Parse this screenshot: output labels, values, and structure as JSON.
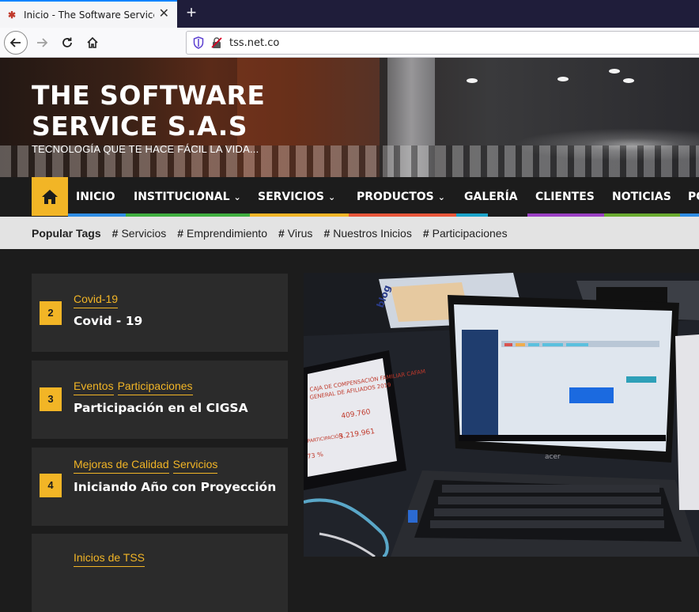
{
  "browser": {
    "tab_title": "Inicio - The Software Service S.A.S",
    "tab_close": "✕",
    "new_tab": "+",
    "url": "tss.net.co"
  },
  "site": {
    "title_line1": "THE SOFTWARE",
    "title_line2": "SERVICE S.A.S",
    "tagline": "TECNOLOGÍA QUE TE HACE FÁCIL LA VIDA..."
  },
  "menu": {
    "items": [
      {
        "label": "INICIO",
        "dropdown": false,
        "color": "#2f8de4"
      },
      {
        "label": "INSTITUCIONAL",
        "dropdown": true,
        "color": "#3fae3f"
      },
      {
        "label": "SERVICIOS",
        "dropdown": true,
        "color": "#f2b526"
      },
      {
        "label": "PRODUCTOS",
        "dropdown": true,
        "color": "#e8563a"
      },
      {
        "label": "GALERÍA",
        "dropdown": false,
        "color": "#1aa3c9"
      },
      {
        "label": "CLIENTES",
        "dropdown": false,
        "color": "#9b3fc4"
      },
      {
        "label": "NOTICIAS",
        "dropdown": false,
        "color": "#6aab2f"
      },
      {
        "label": "PO",
        "dropdown": false,
        "color": "#2f8de4"
      }
    ]
  },
  "tags": {
    "label": "Popular Tags",
    "items": [
      "Servicios",
      "Emprendimiento",
      "Virus",
      "Nuestros Inicios",
      "Participaciones"
    ]
  },
  "posts": [
    {
      "number": "2",
      "categories": [
        "Covid-19"
      ],
      "title": "Covid - 19"
    },
    {
      "number": "3",
      "categories": [
        "Eventos",
        "Participaciones"
      ],
      "title": "Participación en el CIGSA"
    },
    {
      "number": "4",
      "categories": [
        "Mejoras de Calidad",
        "Servicios"
      ],
      "title": "Iniciando Año con Proyección"
    },
    {
      "number": "",
      "categories": [
        "Inicios de TSS"
      ],
      "title": ""
    }
  ],
  "photo": {
    "laptop_brand": "acer",
    "tablet_line1": "CAJA DE COMPENSACIÓN FAMILIAR CAFAM",
    "tablet_line2": "GENERAL DE AFILIADOS 2019",
    "tablet_value1": "409.760",
    "tablet_value2": "3.219.961",
    "tablet_pct": "73 %",
    "tablet_label": "PARTICIPACIÓN"
  },
  "colors": {
    "accent": "#f2b526",
    "menu_bg": "#1c1c1c",
    "card_bg": "#2b2b2b"
  }
}
